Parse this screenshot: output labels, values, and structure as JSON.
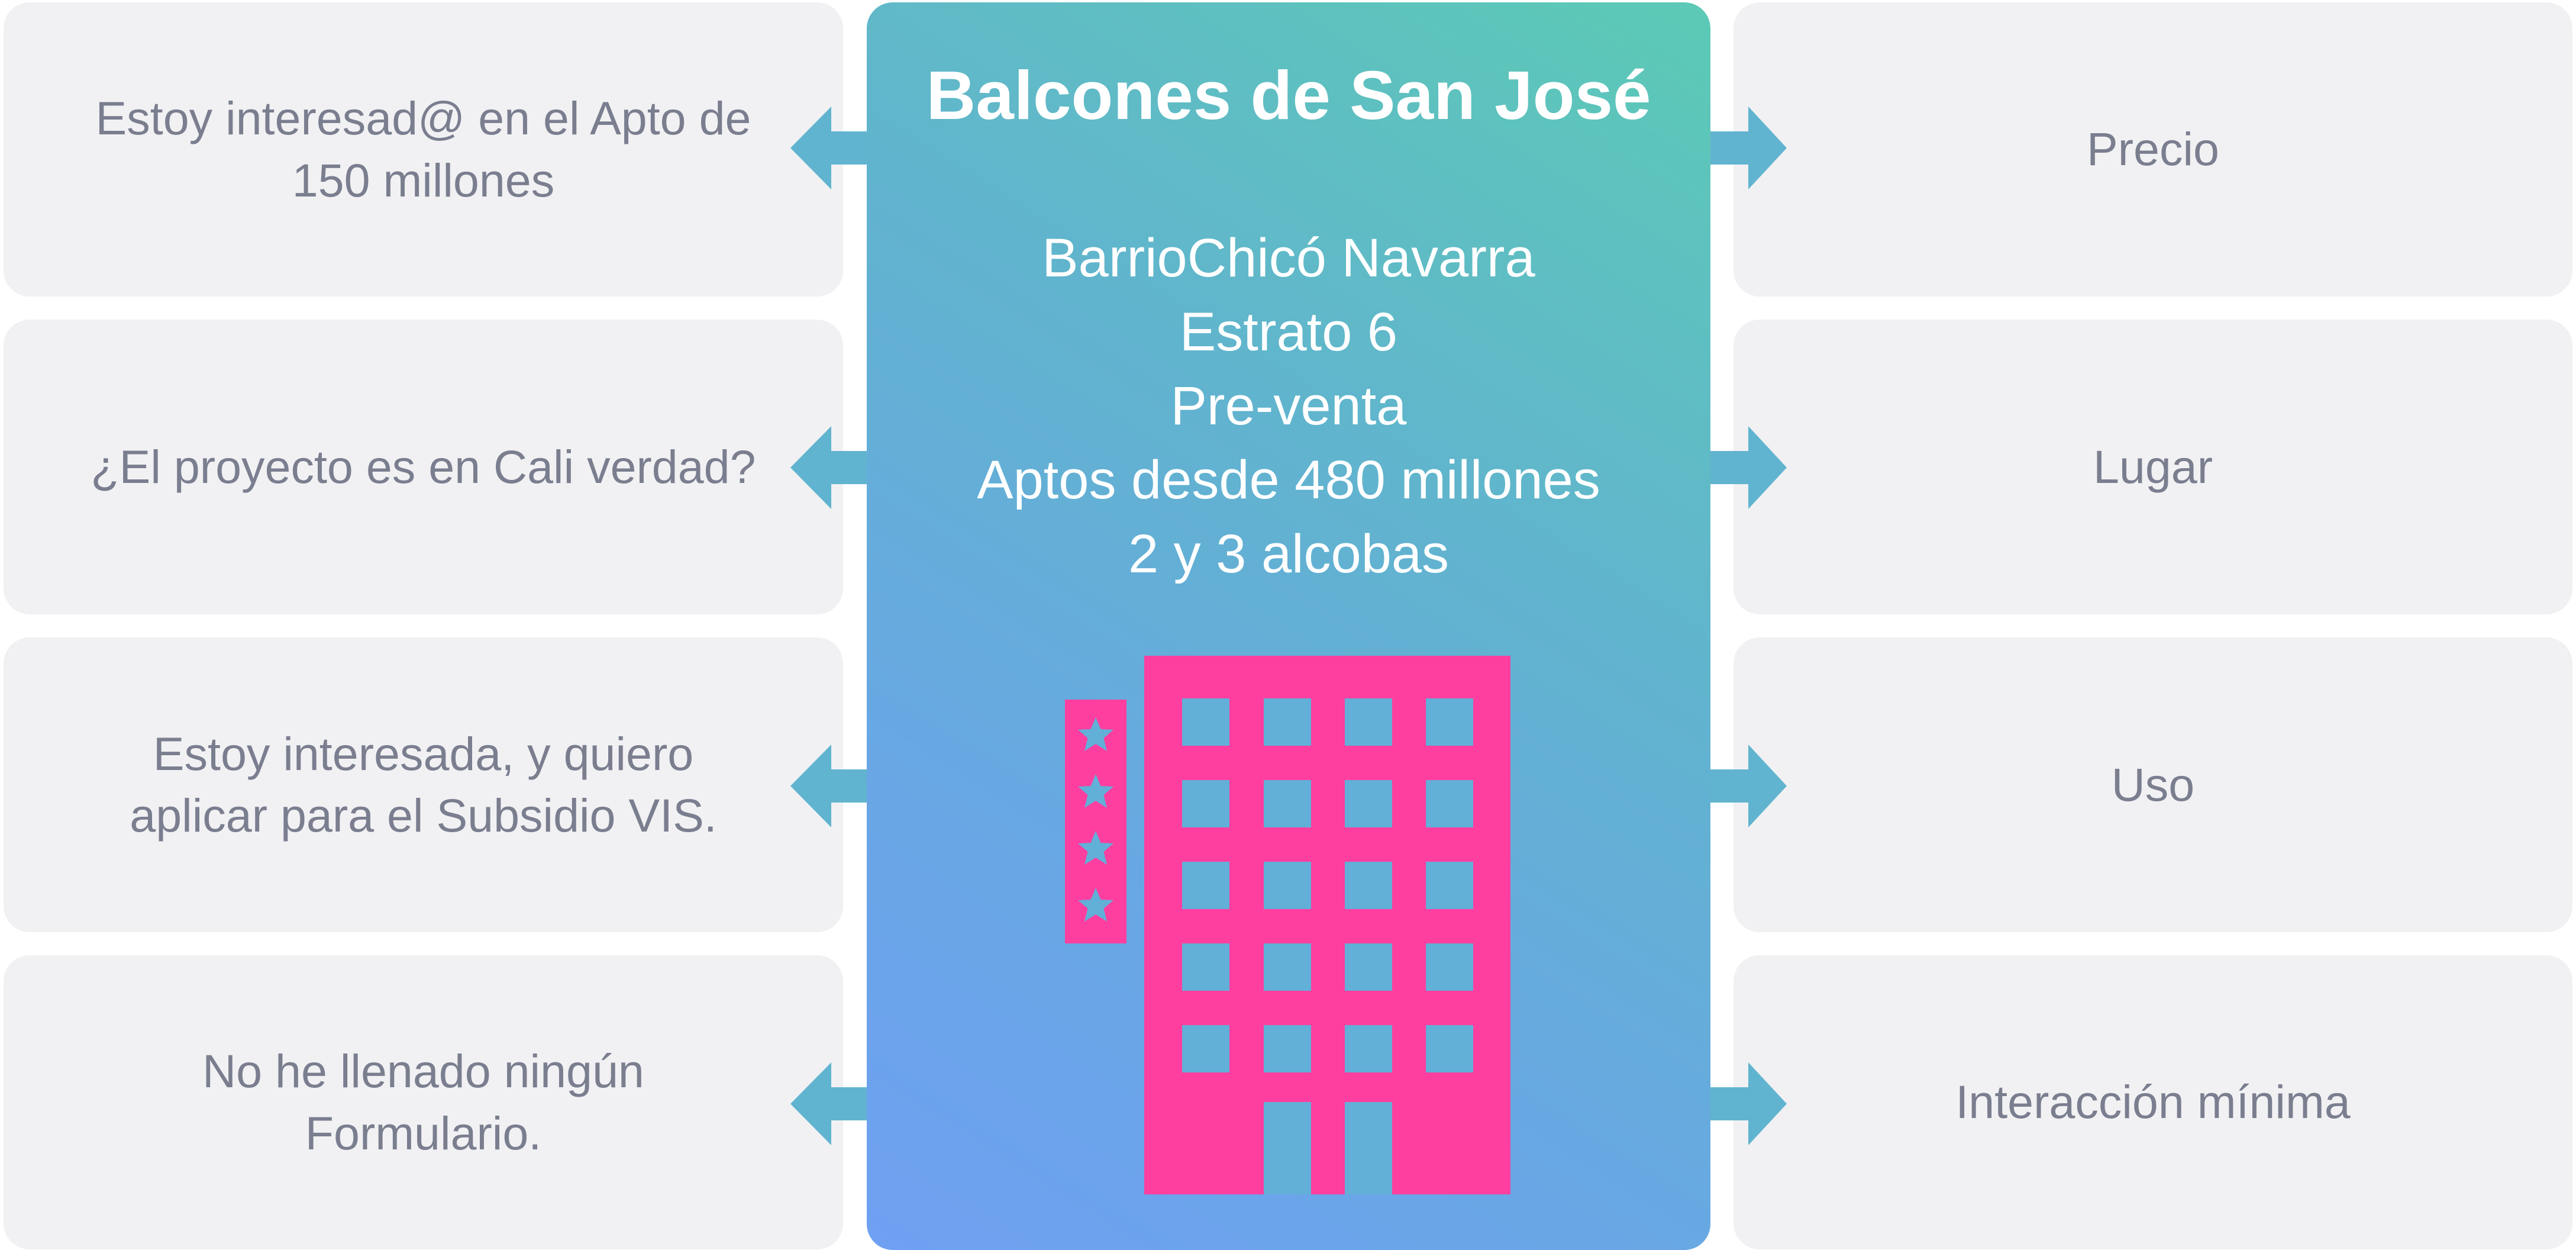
{
  "left_cards": [
    {
      "text": "Estoy interesad@ en el Apto de\n150 millones"
    },
    {
      "text": "¿El proyecto es en Cali verdad?"
    },
    {
      "text": "Estoy interesada, y quiero\naplicar para el Subsidio VIS."
    },
    {
      "text": "No he llenado ningún\nFormulario."
    }
  ],
  "center": {
    "title": "Balcones de San José",
    "details": [
      "BarrioChicó Navarra",
      "Estrato 6",
      "Pre-venta",
      "Aptos desde 480 millones",
      "2 y 3 alcobas"
    ],
    "icon": "hotel-building-icon"
  },
  "right_cards": [
    {
      "text": "Precio"
    },
    {
      "text": "Lugar"
    },
    {
      "text": "Uso"
    },
    {
      "text": "Interacción mínima"
    }
  ],
  "colors": {
    "card_bg": "#f1f1f3",
    "card_text": "#7a7e8f",
    "gradient_top": "#5ccab5",
    "gradient_bottom": "#6fa0f2",
    "arrow": "#61b4cf",
    "building": "#ff3fa0",
    "building_windows": "#62afd8"
  }
}
